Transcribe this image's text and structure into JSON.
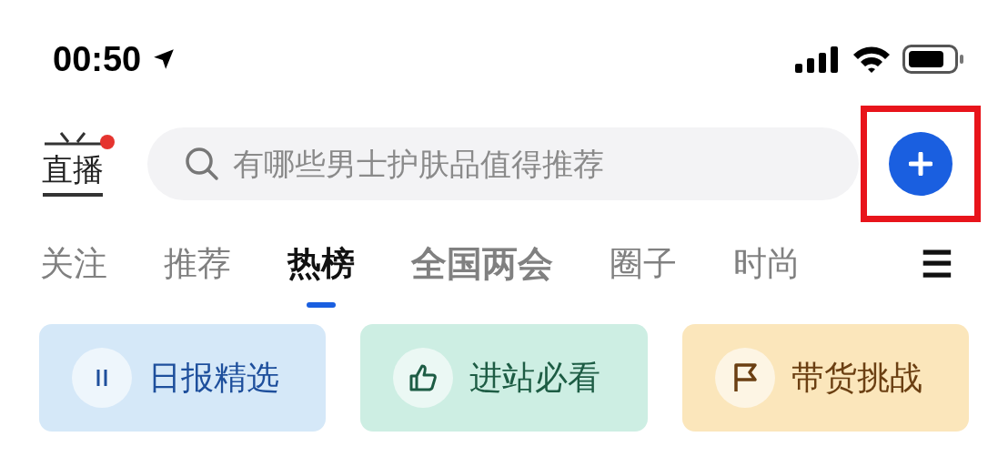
{
  "status_bar": {
    "time": "00:50",
    "location_on": true
  },
  "header": {
    "logo": {
      "text": "直播",
      "badge": true
    },
    "search": {
      "placeholder": "有哪些男士护肤品值得推荐"
    },
    "add_button": {
      "highlighted": true
    }
  },
  "tabs": [
    {
      "label": "关注",
      "selected": false,
      "emphasized": false
    },
    {
      "label": "推荐",
      "selected": false,
      "emphasized": false
    },
    {
      "label": "热榜",
      "selected": true,
      "emphasized": false
    },
    {
      "label": "全国两会",
      "selected": false,
      "emphasized": true
    },
    {
      "label": "圈子",
      "selected": false,
      "emphasized": false
    },
    {
      "label": "时尚",
      "selected": false,
      "emphasized": false
    }
  ],
  "tabs_menu": "☰",
  "cards": [
    {
      "kind": "pause",
      "label": "日报精选",
      "color": "#1e4f9c"
    },
    {
      "kind": "thumb",
      "label": "进站必看",
      "color": "#1d5c44"
    },
    {
      "kind": "flag",
      "label": "带货挑战",
      "color": "#6b3f12"
    }
  ]
}
